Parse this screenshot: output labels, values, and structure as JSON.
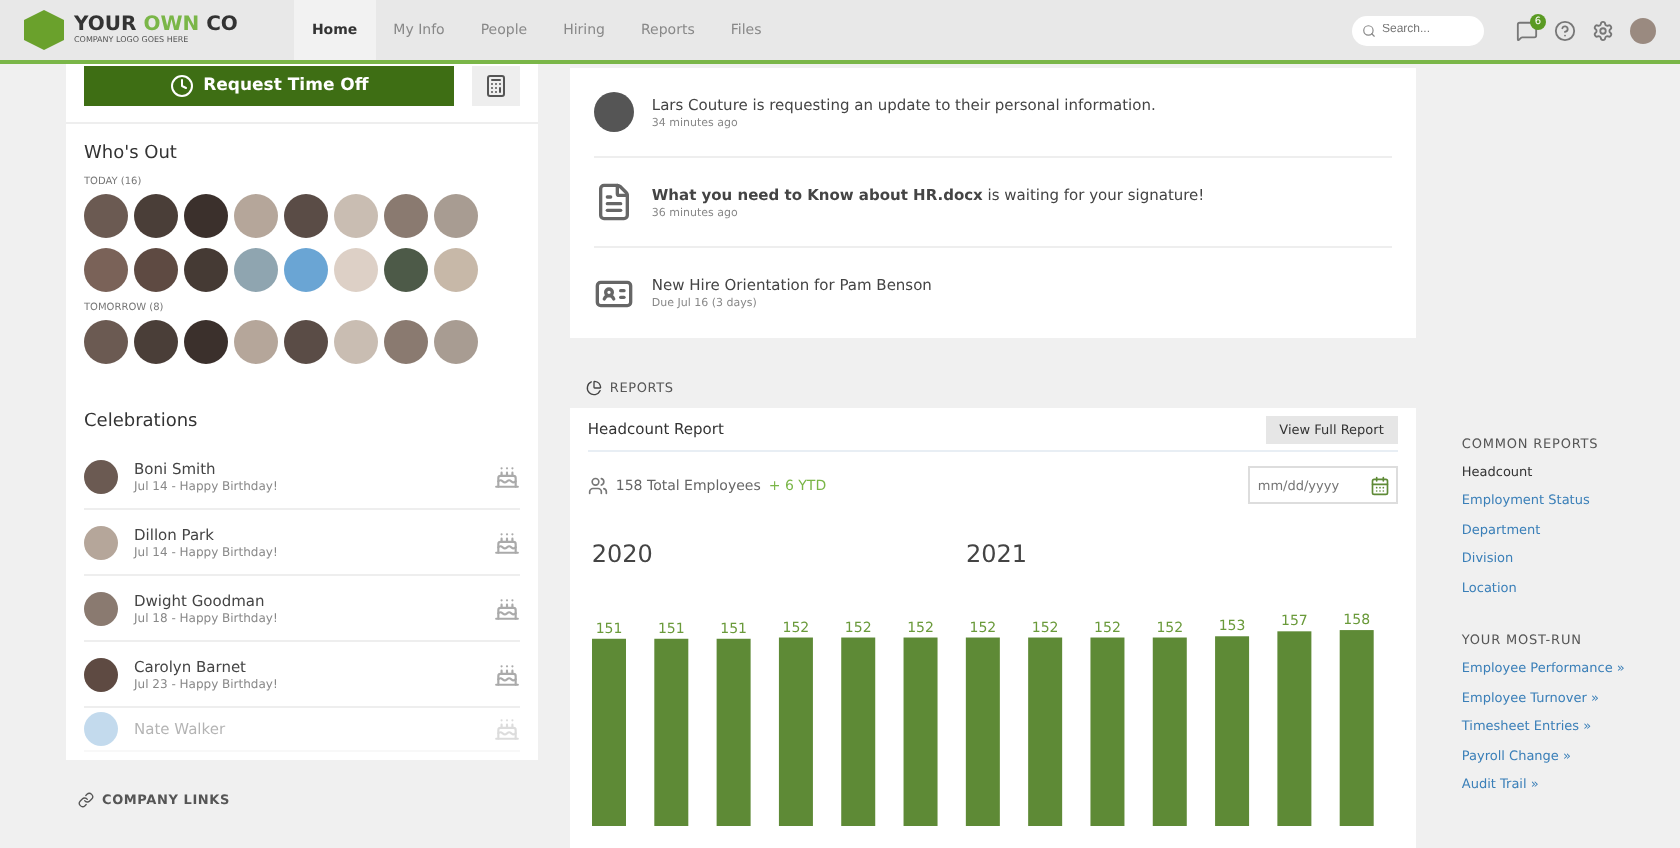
{
  "header": {
    "logo": {
      "words": [
        "YOUR",
        "OWN",
        "CO"
      ],
      "tagline": "COMPANY LOGO GOES HERE"
    },
    "tabs": [
      {
        "label": "Home",
        "selected": true
      },
      {
        "label": "My Info",
        "selected": false
      },
      {
        "label": "People",
        "selected": false
      },
      {
        "label": "Hiring",
        "selected": false
      },
      {
        "label": "Reports",
        "selected": false
      },
      {
        "label": "Files",
        "selected": false
      }
    ],
    "search": {
      "placeholder": "Search..."
    },
    "notification_count": "6"
  },
  "left": {
    "request_button": "Request Time Off",
    "whos_out": {
      "title": "Who's Out",
      "groups": [
        {
          "label": "TODAY (16)"
        },
        {
          "label": "TOMORROW (8)"
        }
      ]
    },
    "celebrations": {
      "title": "Celebrations",
      "items": [
        {
          "name": "Boni Smith",
          "detail": "Jul 14 - Happy Birthday!",
          "faded": false
        },
        {
          "name": "Dillon Park",
          "detail": "Jul 14 - Happy Birthday!",
          "faded": false
        },
        {
          "name": "Dwight Goodman",
          "detail": "Jul 18 - Happy Birthday!",
          "faded": false
        },
        {
          "name": "Carolyn Barnet",
          "detail": "Jul 23 - Happy Birthday!",
          "faded": false
        },
        {
          "name": "Nate Walker",
          "faded": true
        }
      ]
    },
    "company_links": "COMPANY LINKS"
  },
  "notifications": [
    {
      "kind": "person",
      "text": "Lars Couture is requesting an update to their personal information.",
      "time": "34 minutes ago"
    },
    {
      "kind": "document",
      "text": "**What you need to Know about HR.docx** is waiting for your signature!",
      "time": "36 minutes ago"
    },
    {
      "kind": "task",
      "text": "New Hire Orientation for Pam Benson",
      "time": "Due Jul 16 (3 days)"
    }
  ],
  "reports": {
    "heading": "REPORTS",
    "card": {
      "title": "Headcount Report",
      "button": "View Full Report",
      "total": "158 Total Employees",
      "ytd": "+ 6 YTD",
      "date_placeholder": "mm/dd/yyyy",
      "year_labels": [
        "2020",
        "2021"
      ],
      "headcount_bars": {
        "kind": "bar",
        "labels": [
          "151",
          "151",
          "151",
          "152",
          "152",
          "152",
          "152",
          "152",
          "152",
          "152",
          "153",
          "157",
          "158"
        ]
      }
    },
    "sidebar": {
      "sections": [
        {
          "title": "COMMON REPORTS",
          "links": [
            {
              "label": "Headcount",
              "selected": true
            },
            {
              "label": "Employment Status",
              "selected": false
            },
            {
              "label": "Department",
              "selected": false
            },
            {
              "label": "Division",
              "selected": false
            },
            {
              "label": "Location",
              "selected": false
            }
          ]
        },
        {
          "title": "YOUR MOST-RUN",
          "links": [
            {
              "label": "Employee Performance »",
              "selected": false
            },
            {
              "label": "Employee Turnover »",
              "selected": false
            },
            {
              "label": "Timesheet Entries »",
              "selected": false
            },
            {
              "label": "Payroll Change »",
              "selected": false
            },
            {
              "label": "Audit Trail »",
              "selected": false
            }
          ]
        }
      ]
    }
  }
}
